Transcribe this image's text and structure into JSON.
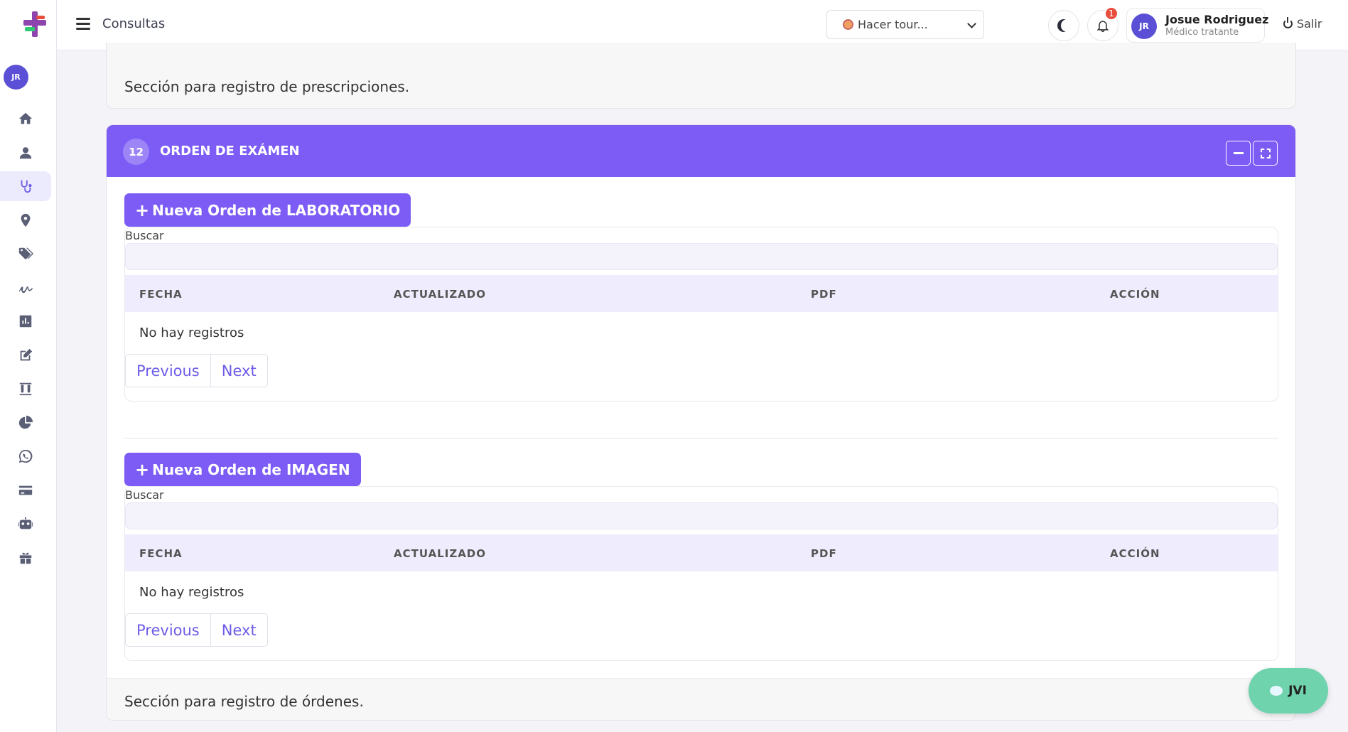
{
  "header": {
    "page_title": "Consultas",
    "tour_select_value": "Hacer tour...",
    "notification_count": "1",
    "user": {
      "initials": "JR",
      "name": "Josue Rodriguez",
      "role": "Médico tratante"
    },
    "logout_label": "Salir"
  },
  "sidebar": {
    "avatar_initials": "JR",
    "items": [
      {
        "icon": "home-icon"
      },
      {
        "icon": "user-icon"
      },
      {
        "icon": "stethoscope-icon",
        "active": true
      },
      {
        "icon": "location-pin-icon"
      },
      {
        "icon": "tags-icon"
      },
      {
        "icon": "signature-icon"
      },
      {
        "icon": "bar-chart-icon"
      },
      {
        "icon": "edit-icon"
      },
      {
        "icon": "test-tubes-icon"
      },
      {
        "icon": "pie-chart-icon"
      },
      {
        "icon": "whatsapp-icon"
      },
      {
        "icon": "credit-card-icon"
      },
      {
        "icon": "robot-icon"
      },
      {
        "icon": "gift-icon"
      }
    ]
  },
  "prescriptions_card": {
    "footer_text": "Sección para registro de prescripciones."
  },
  "exam_card": {
    "number": "12",
    "title": "ORDEN DE EXÁMEN",
    "lab_section": {
      "button_label": "Nueva Orden de LABORATORIO",
      "search_label": "Buscar",
      "columns": [
        "FECHA",
        "ACTUALIZADO",
        "PDF",
        "ACCIÓN"
      ],
      "empty_text": "No hay registros",
      "prev_label": "Previous",
      "next_label": "Next"
    },
    "image_section": {
      "button_label": "Nueva Orden de IMAGEN",
      "search_label": "Buscar",
      "columns": [
        "FECHA",
        "ACTUALIZADO",
        "PDF",
        "ACCIÓN"
      ],
      "empty_text": "No hay registros",
      "prev_label": "Previous",
      "next_label": "Next"
    },
    "footer_text": "Sección para registro de órdenes."
  },
  "chat": {
    "label": "JVI"
  },
  "colors": {
    "accent": "#7c5cf5",
    "avatar": "#5b4fd6",
    "chat": "#6fd3ad",
    "badge": "#e74c3c"
  }
}
